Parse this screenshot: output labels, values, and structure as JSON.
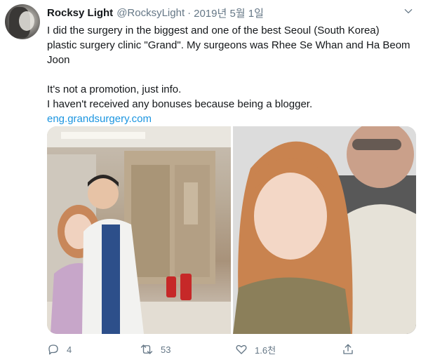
{
  "tweet": {
    "author": {
      "name": "Rocksy Light",
      "handle": "@RocksyLight",
      "separator": "·",
      "date": "2019년 5월 1일"
    },
    "text": {
      "line1": "I did the surgery in the biggest and one of the best Seoul (South Korea) plastic surgery clinic \"Grand\". My surgeons was Rhee Se Whan and Ha Beom Joon",
      "line2": "It's not a promotion, just info.",
      "line3": "I haven't received any bonuses because being a blogger.",
      "link": "eng.grandsurgery.com"
    },
    "actions": {
      "reply_count": "4",
      "retweet_count": "53",
      "like_count": "1.6천",
      "share_label": ""
    },
    "icons": [
      "chevron-down-icon",
      "reply-icon",
      "retweet-icon",
      "heart-icon",
      "share-icon"
    ],
    "colors": {
      "text": "#14171a",
      "secondary": "#657786",
      "link": "#1b95e0"
    }
  }
}
